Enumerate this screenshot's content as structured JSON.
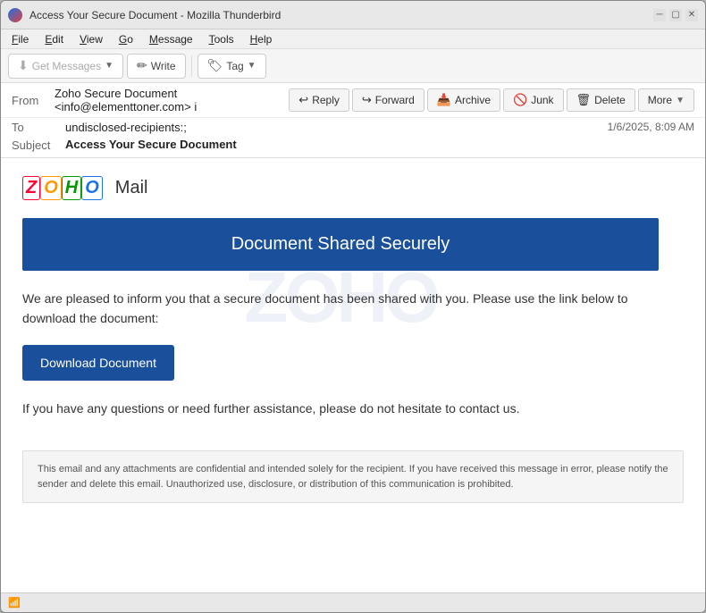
{
  "window": {
    "title": "Access Your Secure Document - Mozilla Thunderbird"
  },
  "menu": {
    "items": [
      "File",
      "Edit",
      "View",
      "Go",
      "Message",
      "Tools",
      "Help"
    ]
  },
  "toolbar": {
    "get_messages_label": "Get Messages",
    "write_label": "Write",
    "tag_label": "Tag"
  },
  "email": {
    "from_label": "From",
    "from_value": "Zoho Secure Document <info@elementtoner.com>",
    "to_label": "To",
    "to_value": "undisclosed-recipients:;",
    "subject_label": "Subject",
    "subject_value": "Access Your Secure Document",
    "date": "1/6/2025, 8:09 AM",
    "actions": {
      "reply": "Reply",
      "forward": "Forward",
      "archive": "Archive",
      "junk": "Junk",
      "delete": "Delete",
      "more": "More"
    }
  },
  "body": {
    "zoho_brand": "ZOHO",
    "mail_label": "Mail",
    "banner_text": "Document Shared Securely",
    "intro_text": "We are pleased to inform you that a secure document has been shared with you. Please use the link below to download the document:",
    "download_button": "Download Document",
    "footer_text": "If you have any questions or need further assistance, please do not hesitate to contact us.",
    "disclaimer": "This email and any attachments are confidential and intended solely for the recipient. If you have received this message in error, please notify the sender and delete this email. Unauthorized use, disclosure, or distribution of this communication is prohibited."
  },
  "status": {
    "wifi_icon": "wifi",
    "text": ""
  },
  "colors": {
    "banner_bg": "#1a4f9c",
    "download_btn_bg": "#1a4f9c",
    "zoho_z": "#ff0033",
    "zoho_o1": "#ff9900",
    "zoho_h": "#009900",
    "zoho_o2": "#1a73e8"
  }
}
